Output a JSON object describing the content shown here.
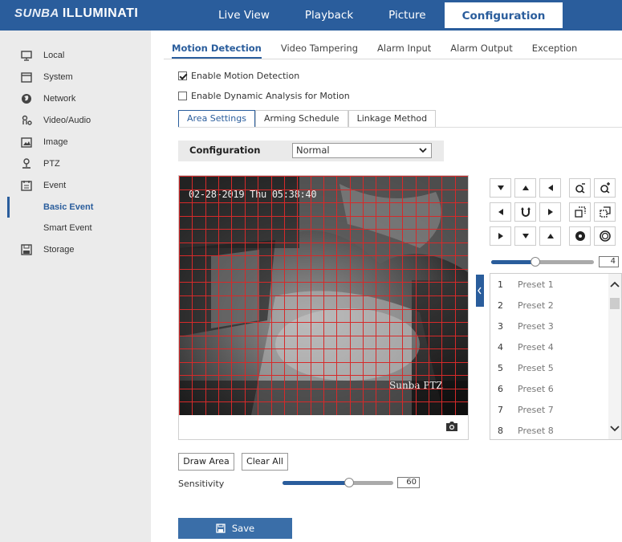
{
  "header": {
    "brand_part1": "SUNBA",
    "brand_part2": "ILLUMINATI",
    "nav": [
      {
        "label": "Live View"
      },
      {
        "label": "Playback"
      },
      {
        "label": "Picture"
      },
      {
        "label": "Configuration",
        "active": true
      }
    ]
  },
  "sidebar": {
    "items": [
      {
        "label": "Local",
        "icon": "monitor-icon"
      },
      {
        "label": "System",
        "icon": "system-icon"
      },
      {
        "label": "Network",
        "icon": "globe-icon"
      },
      {
        "label": "Video/Audio",
        "icon": "video-audio-icon"
      },
      {
        "label": "Image",
        "icon": "image-icon"
      },
      {
        "label": "PTZ",
        "icon": "ptz-icon"
      },
      {
        "label": "Event",
        "icon": "event-icon"
      },
      {
        "label": "Basic Event",
        "sub": true,
        "active": true
      },
      {
        "label": "Smart Event",
        "sub": true
      },
      {
        "label": "Storage",
        "icon": "storage-icon"
      }
    ]
  },
  "tabs": [
    {
      "label": "Motion Detection",
      "active": true
    },
    {
      "label": "Video Tampering"
    },
    {
      "label": "Alarm Input"
    },
    {
      "label": "Alarm Output"
    },
    {
      "label": "Exception"
    }
  ],
  "options": {
    "enable_motion": {
      "label": "Enable Motion Detection",
      "checked": true
    },
    "enable_dynamic": {
      "label": "Enable Dynamic Analysis for Motion",
      "checked": false
    }
  },
  "steps": [
    {
      "label": "Area Settings",
      "active": true
    },
    {
      "label": "Arming Schedule"
    },
    {
      "label": "Linkage Method"
    }
  ],
  "config": {
    "label": "Configuration",
    "value": "Normal"
  },
  "video": {
    "timestamp": "02-28-2019 Thu 05:38:40",
    "watermark": "Sunba PTZ"
  },
  "ptz": {
    "speed_value": "4",
    "speed_fraction": 0.43
  },
  "presets": [
    {
      "num": "1",
      "name": "Preset 1"
    },
    {
      "num": "2",
      "name": "Preset 2"
    },
    {
      "num": "3",
      "name": "Preset 3"
    },
    {
      "num": "4",
      "name": "Preset 4"
    },
    {
      "num": "5",
      "name": "Preset 5"
    },
    {
      "num": "6",
      "name": "Preset 6"
    },
    {
      "num": "7",
      "name": "Preset 7"
    },
    {
      "num": "8",
      "name": "Preset 8"
    }
  ],
  "area_buttons": {
    "draw": "Draw Area",
    "clear": "Clear All"
  },
  "sensitivity": {
    "label": "Sensitivity",
    "value": "60",
    "fraction": 0.6
  },
  "save_label": "Save",
  "colors": {
    "accent": "#2a5d9c",
    "grid_line": "#d62a2a"
  }
}
